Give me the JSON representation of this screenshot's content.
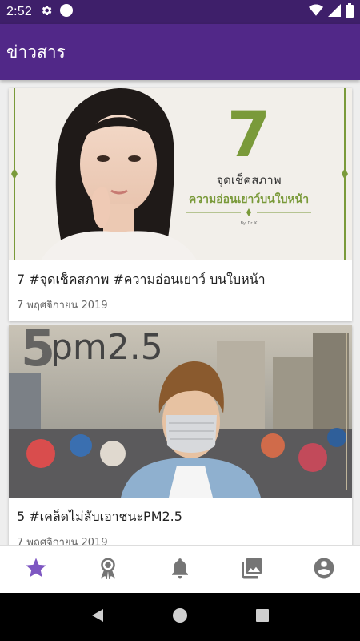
{
  "status_bar": {
    "time": "2:52",
    "icons": [
      "gear-icon",
      "circle-icon",
      "wifi-icon",
      "signal-icon",
      "battery-icon"
    ]
  },
  "app_bar": {
    "title": "ข่าวสาร"
  },
  "cards": [
    {
      "title": "7 #จุดเช็คสภาพ #ความอ่อนเยาว์ บนใบหน้า",
      "date": "7 พฤศจิกายน 2019",
      "image": {
        "big_number": "7",
        "line1": "จุดเช็คสภาพ",
        "line2": "ความอ่อนเยาว์บนใบหน้า",
        "byline": "By. Dr. K"
      }
    },
    {
      "title": "5 #เคล็ดไม่ลับเอาชนะPM2.5",
      "date": "7 พฤศจิกายน 2019",
      "image": {
        "big_number": "5",
        "text": "pm2.5"
      }
    }
  ],
  "bottom_nav": {
    "items": [
      {
        "icon": "star-icon",
        "active": true
      },
      {
        "icon": "award-icon",
        "active": false
      },
      {
        "icon": "bell-icon",
        "active": false
      },
      {
        "icon": "gallery-icon",
        "active": false
      },
      {
        "icon": "account-icon",
        "active": false
      }
    ],
    "active_color": "#7e57c2",
    "inactive_color": "#757575"
  },
  "colors": {
    "status_bar": "#3e1f6a",
    "app_bar": "#512888",
    "accent_green": "#7a9a3a"
  }
}
